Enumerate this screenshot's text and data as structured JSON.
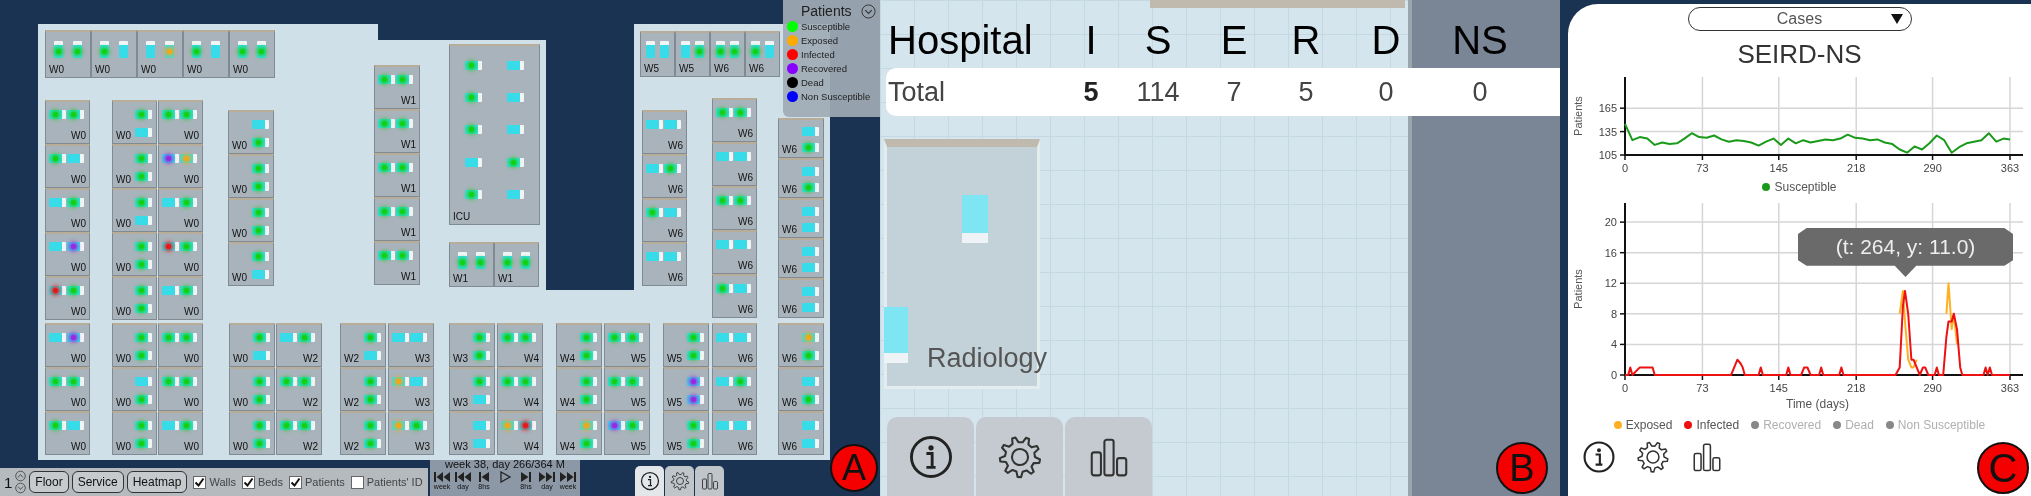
{
  "panel_a": {
    "floor_plan": {
      "blocks": [
        {
          "rooms": [
            {
              "label": "W0",
              "beds": [
                {
                  "kind": "susceptible"
                },
                {
                  "kind": "susceptible"
                }
              ]
            },
            {
              "label": "W0",
              "beds": [
                {
                  "kind": "susceptible"
                },
                {
                  "kind": "empty"
                }
              ]
            },
            {
              "label": "W0",
              "beds": [
                {
                  "kind": "empty"
                },
                {
                  "kind": "exposed"
                }
              ]
            },
            {
              "label": "W0",
              "beds": [
                {
                  "kind": "susceptible"
                },
                {
                  "kind": "empty"
                }
              ]
            },
            {
              "label": "W0",
              "beds": [
                {
                  "kind": "susceptible"
                },
                {
                  "kind": "susceptible"
                }
              ]
            }
          ]
        },
        {
          "rooms": [
            {
              "label": "W5",
              "beds": [
                {
                  "kind": "empty"
                },
                {
                  "kind": "empty"
                }
              ]
            },
            {
              "label": "W5",
              "beds": [
                {
                  "kind": "empty"
                },
                {
                  "kind": "susceptible"
                }
              ]
            },
            {
              "label": "W6",
              "beds": [
                {
                  "kind": "susceptible"
                },
                {
                  "kind": "susceptible"
                }
              ]
            },
            {
              "label": "W6",
              "beds": [
                {
                  "kind": "susceptible"
                },
                {
                  "kind": "empty"
                }
              ]
            }
          ]
        },
        {
          "rooms": [
            {
              "label": "W0",
              "beds": [
                {
                  "kind": "susceptible"
                },
                {
                  "kind": "susceptible"
                }
              ]
            },
            {
              "label": "W0",
              "beds": [
                {
                  "kind": "susceptible"
                },
                {
                  "kind": "empty"
                }
              ]
            },
            {
              "label": "W0",
              "beds": [
                {
                  "kind": "empty"
                },
                {
                  "kind": "susceptible"
                }
              ]
            },
            {
              "label": "W0",
              "beds": [
                {
                  "kind": "empty"
                },
                {
                  "kind": "recovered"
                }
              ]
            },
            {
              "label": "W0",
              "beds": [
                {
                  "kind": "infected"
                },
                {
                  "kind": "susceptible"
                }
              ]
            }
          ]
        },
        {
          "rooms": [
            {
              "label": "W0",
              "beds": [
                {
                  "kind": "susceptible"
                },
                {
                  "kind": "empty"
                }
              ]
            },
            {
              "label": "W0",
              "beds": [
                {
                  "kind": "susceptible"
                },
                {
                  "kind": "susceptible"
                }
              ]
            },
            {
              "label": "W0",
              "beds": [
                {
                  "kind": "susceptible"
                },
                {
                  "kind": "empty"
                }
              ]
            },
            {
              "label": "W0",
              "beds": [
                {
                  "kind": "susceptible"
                },
                {
                  "kind": "susceptible"
                }
              ]
            },
            {
              "label": "W0",
              "beds": [
                {
                  "kind": "susceptible"
                },
                {
                  "kind": "susceptible"
                }
              ]
            }
          ]
        },
        {
          "rooms": [
            {
              "label": "W0",
              "beds": [
                {
                  "kind": "susceptible"
                },
                {
                  "kind": "susceptible"
                }
              ]
            },
            {
              "label": "W0",
              "beds": [
                {
                  "kind": "recovered"
                },
                {
                  "kind": "exposed"
                }
              ]
            },
            {
              "label": "W0",
              "beds": [
                {
                  "kind": "empty"
                },
                {
                  "kind": "susceptible"
                }
              ]
            },
            {
              "label": "W0",
              "beds": [
                {
                  "kind": "infected"
                },
                {
                  "kind": "susceptible"
                }
              ]
            },
            {
              "label": "W0",
              "beds": [
                {
                  "kind": "empty"
                },
                {
                  "kind": "susceptible"
                }
              ]
            }
          ]
        },
        {
          "rooms": [
            {
              "label": "W0",
              "beds": [
                {
                  "kind": "empty"
                },
                {
                  "kind": "susceptible"
                }
              ]
            },
            {
              "label": "W0",
              "beds": [
                {
                  "kind": "susceptible"
                },
                {
                  "kind": "susceptible"
                }
              ]
            },
            {
              "label": "W0",
              "beds": [
                {
                  "kind": "susceptible"
                },
                {
                  "kind": "susceptible"
                }
              ]
            },
            {
              "label": "W0",
              "beds": [
                {
                  "kind": "susceptible"
                },
                {
                  "kind": "empty"
                }
              ]
            }
          ]
        },
        {
          "rooms": [
            {
              "label": "W1",
              "beds": [
                {
                  "kind": "susceptible"
                },
                {
                  "kind": "susceptible"
                }
              ]
            },
            {
              "label": "W1",
              "beds": [
                {
                  "kind": "susceptible"
                },
                {
                  "kind": "susceptible"
                }
              ]
            },
            {
              "label": "W1",
              "beds": [
                {
                  "kind": "susceptible"
                },
                {
                  "kind": "susceptible"
                }
              ]
            },
            {
              "label": "W1",
              "beds": [
                {
                  "kind": "susceptible"
                },
                {
                  "kind": "susceptible"
                }
              ]
            },
            {
              "label": "W1",
              "beds": [
                {
                  "kind": "susceptible"
                },
                {
                  "kind": "susceptible"
                }
              ]
            }
          ]
        },
        {
          "rooms": [
            {
              "label": "ICU",
              "beds": [
                {
                  "kind": "susceptible"
                },
                {
                  "kind": "empty"
                },
                {
                  "kind": "susceptible"
                },
                {
                  "kind": "empty"
                },
                {
                  "kind": "susceptible"
                },
                {
                  "kind": "empty"
                },
                {
                  "kind": "empty"
                },
                {
                  "kind": "susceptible"
                },
                {
                  "kind": "susceptible"
                },
                {
                  "kind": "empty"
                }
              ]
            }
          ]
        },
        {
          "rooms": [
            {
              "label": "W1",
              "beds": [
                {
                  "kind": "susceptible"
                },
                {
                  "kind": "susceptible"
                }
              ]
            },
            {
              "label": "W1",
              "beds": [
                {
                  "kind": "susceptible"
                },
                {
                  "kind": "susceptible"
                }
              ]
            }
          ]
        },
        {
          "rooms": [
            {
              "label": "W6",
              "beds": [
                {
                  "kind": "empty"
                },
                {
                  "kind": "empty"
                }
              ]
            },
            {
              "label": "W6",
              "beds": [
                {
                  "kind": "empty"
                },
                {
                  "kind": "susceptible"
                }
              ]
            },
            {
              "label": "W6",
              "beds": [
                {
                  "kind": "susceptible"
                },
                {
                  "kind": "empty"
                }
              ]
            },
            {
              "label": "W6",
              "beds": [
                {
                  "kind": "empty"
                },
                {
                  "kind": "empty"
                }
              ]
            }
          ]
        },
        {
          "rooms": [
            {
              "label": "W6",
              "beds": [
                {
                  "kind": "susceptible"
                },
                {
                  "kind": "susceptible"
                }
              ]
            },
            {
              "label": "W6",
              "beds": [
                {
                  "kind": "empty"
                },
                {
                  "kind": "empty"
                }
              ]
            },
            {
              "label": "W6",
              "beds": [
                {
                  "kind": "susceptible"
                },
                {
                  "kind": "susceptible"
                }
              ]
            },
            {
              "label": "W6",
              "beds": [
                {
                  "kind": "empty"
                },
                {
                  "kind": "empty"
                }
              ]
            },
            {
              "label": "W6",
              "beds": [
                {
                  "kind": "susceptible"
                },
                {
                  "kind": "empty"
                }
              ]
            }
          ]
        },
        {
          "rooms": [
            {
              "label": "W6",
              "beds": [
                {
                  "kind": "empty"
                },
                {
                  "kind": "susceptible"
                }
              ]
            },
            {
              "label": "W6",
              "beds": [
                {
                  "kind": "empty"
                },
                {
                  "kind": "susceptible"
                }
              ]
            },
            {
              "label": "W6",
              "beds": [
                {
                  "kind": "empty"
                },
                {
                  "kind": "empty"
                }
              ]
            },
            {
              "label": "W6",
              "beds": [
                {
                  "kind": "empty"
                },
                {
                  "kind": "empty"
                }
              ]
            },
            {
              "label": "W6",
              "beds": [
                {
                  "kind": "empty"
                },
                {
                  "kind": "empty"
                }
              ]
            }
          ]
        },
        {
          "rooms": [
            {
              "label": "W0",
              "beds": [
                {
                  "kind": "empty"
                },
                {
                  "kind": "recovered"
                }
              ]
            },
            {
              "label": "W0",
              "beds": [
                {
                  "kind": "susceptible"
                },
                {
                  "kind": "susceptible"
                }
              ]
            },
            {
              "label": "W0",
              "beds": [
                {
                  "kind": "susceptible"
                },
                {
                  "kind": "empty"
                }
              ]
            }
          ]
        },
        {
          "rooms": [
            {
              "label": "W0",
              "beds": [
                {
                  "kind": "susceptible"
                },
                {
                  "kind": "susceptible"
                }
              ]
            },
            {
              "label": "W0",
              "beds": [
                {
                  "kind": "empty"
                },
                {
                  "kind": "susceptible"
                }
              ]
            },
            {
              "label": "W0",
              "beds": [
                {
                  "kind": "susceptible"
                },
                {
                  "kind": "susceptible"
                }
              ]
            }
          ]
        },
        {
          "rooms": [
            {
              "label": "W0",
              "beds": [
                {
                  "kind": "susceptible"
                },
                {
                  "kind": "susceptible"
                }
              ]
            },
            {
              "label": "W0",
              "beds": [
                {
                  "kind": "susceptible"
                },
                {
                  "kind": "susceptible"
                }
              ]
            },
            {
              "label": "W0",
              "beds": [
                {
                  "kind": "empty"
                },
                {
                  "kind": "susceptible"
                }
              ]
            }
          ]
        },
        {
          "rooms": [
            {
              "label": "W0",
              "beds": [
                {
                  "kind": "susceptible"
                },
                {
                  "kind": "empty"
                }
              ]
            },
            {
              "label": "W0",
              "beds": [
                {
                  "kind": "susceptible"
                },
                {
                  "kind": "susceptible"
                }
              ]
            },
            {
              "label": "W0",
              "beds": [
                {
                  "kind": "susceptible"
                },
                {
                  "kind": "susceptible"
                }
              ]
            }
          ]
        },
        {
          "rooms": [
            {
              "label": "W2",
              "beds": [
                {
                  "kind": "empty"
                },
                {
                  "kind": "susceptible"
                }
              ]
            },
            {
              "label": "W2",
              "beds": [
                {
                  "kind": "susceptible"
                },
                {
                  "kind": "susceptible"
                }
              ]
            },
            {
              "label": "W2",
              "beds": [
                {
                  "kind": "susceptible"
                },
                {
                  "kind": "susceptible"
                }
              ]
            }
          ]
        },
        {
          "rooms": [
            {
              "label": "W2",
              "beds": [
                {
                  "kind": "susceptible"
                },
                {
                  "kind": "empty"
                }
              ]
            },
            {
              "label": "W2",
              "beds": [
                {
                  "kind": "susceptible"
                },
                {
                  "kind": "susceptible"
                }
              ]
            },
            {
              "label": "W2",
              "beds": [
                {
                  "kind": "susceptible"
                },
                {
                  "kind": "susceptible"
                }
              ]
            }
          ]
        },
        {
          "rooms": [
            {
              "label": "W3",
              "beds": [
                {
                  "kind": "empty"
                },
                {
                  "kind": "empty"
                }
              ]
            },
            {
              "label": "W3",
              "beds": [
                {
                  "kind": "exposed"
                },
                {
                  "kind": "empty"
                }
              ]
            },
            {
              "label": "W3",
              "beds": [
                {
                  "kind": "exposed"
                },
                {
                  "kind": "susceptible"
                }
              ]
            }
          ]
        },
        {
          "rooms": [
            {
              "label": "W3",
              "beds": [
                {
                  "kind": "susceptible"
                },
                {
                  "kind": "susceptible"
                }
              ]
            },
            {
              "label": "W3",
              "beds": [
                {
                  "kind": "susceptible"
                },
                {
                  "kind": "empty"
                }
              ]
            },
            {
              "label": "W3",
              "beds": [
                {
                  "kind": "empty"
                },
                {
                  "kind": "empty"
                }
              ]
            }
          ]
        },
        {
          "rooms": [
            {
              "label": "W4",
              "beds": [
                {
                  "kind": "susceptible"
                },
                {
                  "kind": "susceptible"
                }
              ]
            },
            {
              "label": "W4",
              "beds": [
                {
                  "kind": "susceptible"
                },
                {
                  "kind": "susceptible"
                }
              ]
            },
            {
              "label": "W4",
              "beds": [
                {
                  "kind": "exposed"
                },
                {
                  "kind": "infected"
                }
              ]
            }
          ]
        },
        {
          "rooms": [
            {
              "label": "W4",
              "beds": [
                {
                  "kind": "susceptible"
                },
                {
                  "kind": "susceptible"
                }
              ]
            },
            {
              "label": "W4",
              "beds": [
                {
                  "kind": "susceptible"
                },
                {
                  "kind": "susceptible"
                }
              ]
            },
            {
              "label": "W4",
              "beds": [
                {
                  "kind": "exposed"
                },
                {
                  "kind": "susceptible"
                }
              ]
            }
          ]
        },
        {
          "rooms": [
            {
              "label": "W5",
              "beds": [
                {
                  "kind": "susceptible"
                },
                {
                  "kind": "susceptible"
                }
              ]
            },
            {
              "label": "W5",
              "beds": [
                {
                  "kind": "susceptible"
                },
                {
                  "kind": "susceptible"
                }
              ]
            },
            {
              "label": "W5",
              "beds": [
                {
                  "kind": "recovered"
                },
                {
                  "kind": "susceptible"
                }
              ]
            }
          ]
        },
        {
          "rooms": [
            {
              "label": "W5",
              "beds": [
                {
                  "kind": "susceptible"
                },
                {
                  "kind": "susceptible"
                }
              ]
            },
            {
              "label": "W5",
              "beds": [
                {
                  "kind": "recovered"
                },
                {
                  "kind": "recovered"
                }
              ]
            },
            {
              "label": "W5",
              "beds": [
                {
                  "kind": "susceptible"
                },
                {
                  "kind": "susceptible"
                }
              ]
            }
          ]
        },
        {
          "rooms": [
            {
              "label": "W6",
              "beds": [
                {
                  "kind": "empty"
                },
                {
                  "kind": "empty"
                }
              ]
            },
            {
              "label": "W6",
              "beds": [
                {
                  "kind": "empty"
                },
                {
                  "kind": "susceptible"
                }
              ]
            },
            {
              "label": "W6",
              "beds": [
                {
                  "kind": "empty"
                },
                {
                  "kind": "empty"
                }
              ]
            }
          ]
        },
        {
          "rooms": [
            {
              "label": "W6",
              "beds": [
                {
                  "kind": "exposed"
                },
                {
                  "kind": "susceptible"
                }
              ]
            },
            {
              "label": "W6",
              "beds": [
                {
                  "kind": "empty"
                },
                {
                  "kind": "susceptible"
                }
              ]
            },
            {
              "label": "W6",
              "beds": [
                {
                  "kind": "empty"
                },
                {
                  "kind": "empty"
                }
              ]
            }
          ]
        }
      ]
    },
    "legend": {
      "title": "Patients",
      "items": [
        {
          "label": "Susceptible",
          "color": "#00ff00"
        },
        {
          "label": "Exposed",
          "color": "#ffaa00"
        },
        {
          "label": "Infected",
          "color": "#ff0000"
        },
        {
          "label": "Recovered",
          "color": "#8800ff"
        },
        {
          "label": "Dead",
          "color": "#000000"
        },
        {
          "label": "Non Susceptible",
          "color": "#0000ff"
        }
      ]
    },
    "floor_selector": {
      "value": "1"
    },
    "view_buttons": [
      "Floor",
      "Service",
      "Heatmap"
    ],
    "toggles": [
      {
        "label": "Walls",
        "checked": true
      },
      {
        "label": "Beds",
        "checked": true
      },
      {
        "label": "Patients",
        "checked": true
      },
      {
        "label": "Patients' ID",
        "checked": false
      }
    ],
    "time_control": {
      "date": "week 38, day 266/364 M",
      "buttons": [
        {
          "kind": "rewind",
          "label": "week"
        },
        {
          "kind": "rewind",
          "label": "day"
        },
        {
          "kind": "step-back",
          "label": "8hs"
        },
        {
          "kind": "play"
        },
        {
          "kind": "step-forward",
          "label": "8hs"
        },
        {
          "kind": "fast-forward",
          "label": "day"
        },
        {
          "kind": "fast-forward",
          "label": "week"
        }
      ]
    },
    "tool_tabs": [
      {
        "selected": true
      },
      {
        "selected": false
      },
      {
        "selected": false
      }
    ],
    "marker": "A"
  },
  "panel_b": {
    "table": {
      "columns": [
        "Hospital",
        "I",
        "S",
        "E",
        "R",
        "D",
        "NS"
      ],
      "rows": [
        {
          "cells": [
            {
              "text": "Total",
              "bold": false
            },
            {
              "text": "5",
              "bold": true
            },
            {
              "text": "114",
              "bold": false
            },
            {
              "text": "7",
              "bold": false
            },
            {
              "text": "5",
              "bold": false
            },
            {
              "text": "0",
              "bold": false
            },
            {
              "text": "0",
              "bold": false
            }
          ]
        }
      ]
    },
    "room": {
      "label": "Radiology"
    },
    "tool_tabs": [
      {
        "selected": false
      },
      {
        "selected": false
      },
      {
        "selected": false
      }
    ],
    "marker": "B"
  },
  "panel_c": {
    "dropdown": {
      "value": "Cases"
    },
    "title": "SEIRD-NS",
    "charts": [
      {
        "chart_data": {
          "type": "line",
          "grid": true,
          "ylabel": "Patients",
          "xlim": [
            0,
            363
          ],
          "ylim": [
            105,
            205
          ],
          "xticks": [
            0,
            73,
            145,
            218,
            290,
            363
          ],
          "yticks": [
            105,
            135,
            165
          ],
          "x": [
            0,
            7,
            14,
            21,
            28,
            35,
            42,
            49,
            56,
            63,
            70,
            77,
            84,
            91,
            98,
            105,
            112,
            119,
            126,
            133,
            140,
            147,
            154,
            161,
            168,
            175,
            182,
            189,
            196,
            203,
            210,
            217,
            224,
            231,
            238,
            245,
            252,
            259,
            266,
            273,
            280,
            287,
            294,
            301,
            308,
            315,
            322,
            329,
            336,
            343,
            350,
            357,
            363
          ],
          "series": [
            {
              "name": "Susceptible",
              "color": "#1a9a1a",
              "values": [
                145,
                124,
                128,
                126,
                118,
                121,
                119,
                120,
                126,
                133,
                128,
                127,
                130,
                125,
                122,
                124,
                123,
                121,
                117,
                122,
                126,
                118,
                126,
                120,
                124,
                121,
                123,
                125,
                124,
                126,
                131,
                127,
                126,
                124,
                125,
                121,
                119,
                112,
                108,
                116,
                112,
                120,
                130,
                124,
                108,
                115,
                120,
                122,
                124,
                133,
                122,
                126,
                125
              ]
            }
          ]
        }
      },
      {
        "chart_data": {
          "type": "line",
          "grid": true,
          "xlabel": "Time (days)",
          "ylabel": "Patients",
          "xlim": [
            0,
            363
          ],
          "ylim": [
            0,
            22.5
          ],
          "xticks": [
            0,
            73,
            145,
            218,
            290,
            363
          ],
          "yticks": [
            0,
            4,
            8,
            12,
            16,
            20
          ],
          "x": [
            0,
            3,
            5,
            7,
            14,
            16,
            22,
            26,
            28,
            30,
            100,
            103,
            106,
            109,
            111,
            113,
            126,
            128,
            130,
            132,
            152,
            154,
            156,
            158,
            166,
            169,
            172,
            175,
            183,
            185,
            187,
            202,
            204,
            206,
            208,
            255,
            259,
            262,
            264,
            267,
            270,
            272,
            275,
            278,
            281,
            283,
            286,
            292,
            294,
            296,
            300,
            303,
            305,
            308,
            310,
            313,
            316,
            318,
            320,
            338,
            340,
            342,
            344,
            346,
            363
          ],
          "series": [
            {
              "name": "Exposed",
              "color": "#ffb020",
              "values": [
                null,
                null,
                null,
                null,
                null,
                null,
                null,
                null,
                null,
                null,
                null,
                null,
                null,
                null,
                null,
                null,
                null,
                null,
                null,
                null,
                null,
                null,
                null,
                null,
                null,
                null,
                null,
                null,
                null,
                null,
                null,
                null,
                null,
                null,
                null,
                null,
                8,
                11,
                7,
                2,
                1,
                1,
                2,
                null,
                null,
                null,
                null,
                null,
                null,
                null,
                null,
                8,
                12,
                6,
                8,
                4,
                null,
                null,
                null,
                null,
                null,
                null,
                null,
                null,
                null
              ]
            },
            {
              "name": "Infected",
              "color": "#ee1111",
              "values": [
                0,
                0,
                1,
                0,
                1,
                1,
                1,
                1,
                0,
                0,
                0,
                1,
                2,
                1.5,
                1,
                0,
                0,
                1,
                0,
                0,
                0,
                1,
                0,
                0,
                0,
                1,
                1,
                0,
                0,
                1,
                0,
                0,
                1,
                0,
                0,
                0,
                1,
                9,
                11,
                8,
                2,
                2,
                1,
                0,
                1,
                1,
                0,
                0,
                1,
                0,
                0,
                5,
                7,
                7,
                8,
                6,
                1,
                0,
                0,
                0,
                1,
                0,
                1,
                0,
                0
              ]
            }
          ]
        },
        "tooltip": "(t: 264, y: 11.0)",
        "legend": [
          {
            "label": "Recovered",
            "color": "#888888",
            "enabled": false
          },
          {
            "label": "Dead",
            "color": "#888888",
            "enabled": false
          },
          {
            "label": "Non Susceptible",
            "color": "#888888",
            "enabled": false
          }
        ]
      }
    ],
    "marker": "C"
  }
}
